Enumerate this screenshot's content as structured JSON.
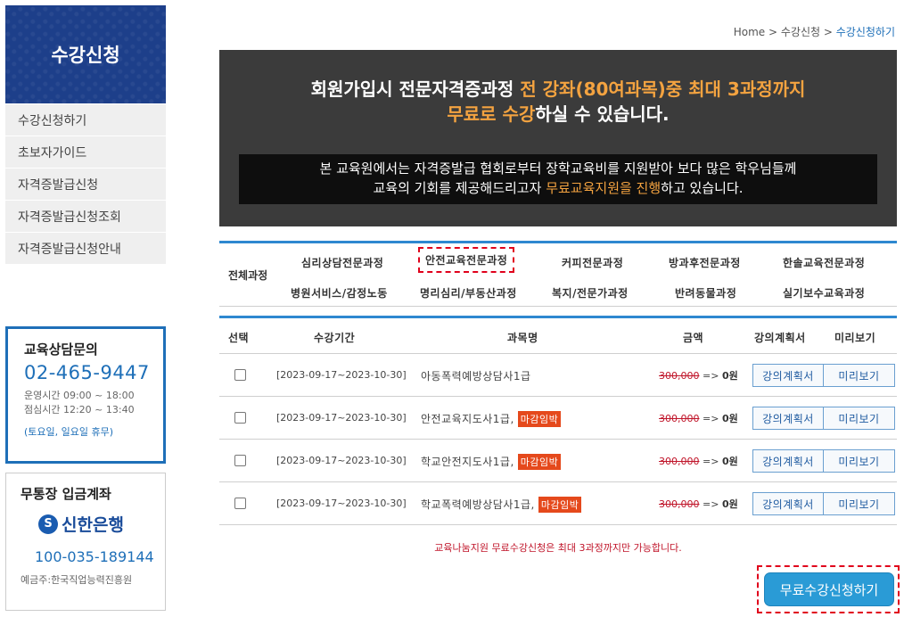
{
  "sidebar": {
    "title": "수강신청",
    "items": [
      {
        "label": "수강신청하기"
      },
      {
        "label": "초보자가이드"
      },
      {
        "label": "자격증발급신청"
      },
      {
        "label": "자격증발급신청조회"
      },
      {
        "label": "자격증발급신청안내"
      }
    ],
    "contact": {
      "title": "교육상담문의",
      "phone": "02-465-9447",
      "hours1": "운영시간 09:00 ~ 18:00",
      "hours2": "점심시간 12:20 ~ 13:40",
      "holiday": "(토요일, 일요일 휴무)"
    },
    "bank": {
      "title": "무통장 입금계좌",
      "bank_name": "신한은행",
      "account": "100-035-189144",
      "holder": "예금주:한국직업능력진흥원"
    }
  },
  "breadcrumb": {
    "home": "Home",
    "sep": ">",
    "level1": "수강신청",
    "current": "수강신청하기"
  },
  "banner": {
    "line1_a": "회원가입시 전문자격증과정 ",
    "line1_hl": "전 강좌(80여과목)중 최대 3과정까지",
    "line2_hl": "무료로 수강",
    "line2_b": "하실 수 있습니다.",
    "inner1": "본 교육원에서는 자격증발급 협회로부터 장학교육비를 지원받아 보다 많은 학우님들께",
    "inner2_a": "교육의 기회를 제공해드리고자 ",
    "inner2_hl": "무료교육지원을 진행",
    "inner2_b": "하고 있습니다."
  },
  "categories": {
    "all": "전체과정",
    "items": [
      {
        "label": "심리상담전문과정"
      },
      {
        "label": "안전교육전문과정"
      },
      {
        "label": "커피전문과정"
      },
      {
        "label": "방과후전문과정"
      },
      {
        "label": "한솔교육전문과정"
      },
      {
        "label": "병원서비스/감정노동"
      },
      {
        "label": "명리심리/부동산과정"
      },
      {
        "label": "복지/전문가과정"
      },
      {
        "label": "반려동물과정"
      },
      {
        "label": "실기보수교육과정"
      }
    ],
    "selected": "안전교육전문과정"
  },
  "table": {
    "headers": {
      "select": "선택",
      "period": "수강기간",
      "subject": "과목명",
      "price": "금액",
      "plan": "강의계획서",
      "preview": "미리보기"
    },
    "rows": [
      {
        "period": "[2023-09-17~2023-10-30]",
        "subject": "아동폭력예방상담사1급",
        "badge": "",
        "old_price": "300,000",
        "arrow": " => ",
        "new_price": "0원",
        "plan": "강의계획서",
        "preview": "미리보기"
      },
      {
        "period": "[2023-09-17~2023-10-30]",
        "subject": "안전교육지도사1급,",
        "badge": "마감임박",
        "old_price": "300,000",
        "arrow": " => ",
        "new_price": "0원",
        "plan": "강의계획서",
        "preview": "미리보기"
      },
      {
        "period": "[2023-09-17~2023-10-30]",
        "subject": "학교안전지도사1급,",
        "badge": "마감임박",
        "old_price": "300,000",
        "arrow": " => ",
        "new_price": "0원",
        "plan": "강의계획서",
        "preview": "미리보기"
      },
      {
        "period": "[2023-09-17~2023-10-30]",
        "subject": "학교폭력예방상담사1급,",
        "badge": "마감임박",
        "old_price": "300,000",
        "arrow": " => ",
        "new_price": "0원",
        "plan": "강의계획서",
        "preview": "미리보기"
      }
    ]
  },
  "notice": "교육나눔지원 무료수강신청은 최대 3과정까지만 가능합니다.",
  "submit_label": "무료수강신청하기"
}
